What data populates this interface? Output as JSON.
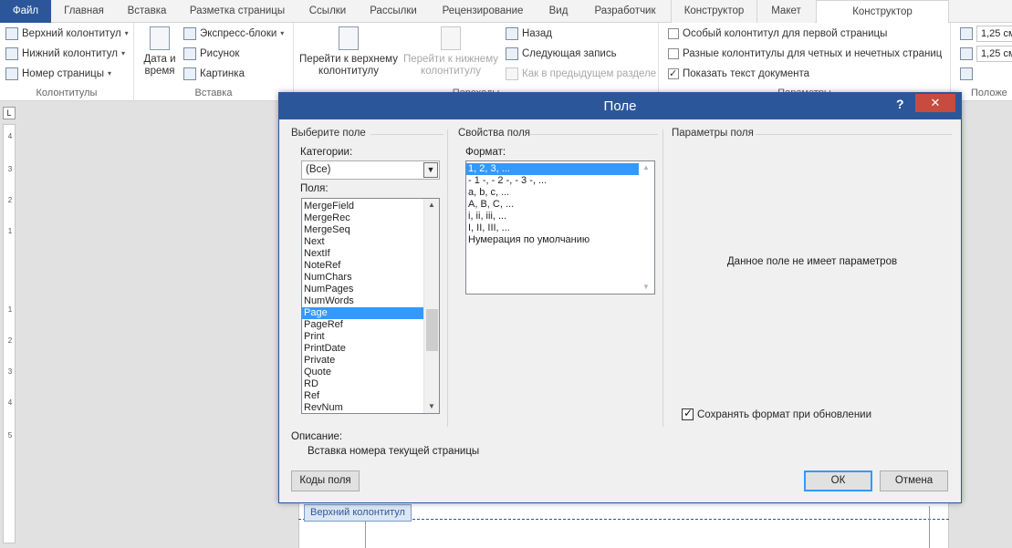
{
  "tabs": {
    "file": "Файл",
    "home": "Главная",
    "insert": "Вставка",
    "layout": "Разметка страницы",
    "references": "Ссылки",
    "mailings": "Рассылки",
    "review": "Рецензирование",
    "view": "Вид",
    "developer": "Разработчик",
    "constructor1": "Конструктор",
    "maket": "Макет",
    "constructor2": "Конструктор"
  },
  "ribbon": {
    "headers_group": {
      "label": "Колонтитулы",
      "header": "Верхний колонтитул",
      "footer": "Нижний колонтитул",
      "page_number": "Номер страницы"
    },
    "insert_group": {
      "label": "Вставка",
      "date_line1": "Дата и",
      "date_line2": "время",
      "quick_parts": "Экспресс-блоки",
      "picture": "Рисунок",
      "clip_art": "Картинка"
    },
    "nav_group": {
      "label": "Переходы",
      "goto_header_l1": "Перейти к верхнему",
      "goto_header_l2": "колонтитулу",
      "goto_footer_l1": "Перейти к нижнему",
      "goto_footer_l2": "колонтитулу",
      "back": "Назад",
      "next": "Следующая запись",
      "link_prev": "Как в предыдущем разделе"
    },
    "options_group": {
      "label": "Параметры",
      "first_page": "Особый колонтитул для первой страницы",
      "odd_even": "Разные колонтитулы для четных и нечетных страниц",
      "show_text": "Показать текст документа",
      "first_page_checked": false,
      "odd_even_checked": false,
      "show_text_checked": true
    },
    "position_group": {
      "label": "Положе",
      "top_value": "1,25 см",
      "bottom_value": "1,25 см"
    }
  },
  "ruler": {
    "numbers": [
      "4",
      "3",
      "2",
      "1",
      "1",
      "2",
      "3",
      "4",
      "5"
    ]
  },
  "document": {
    "header_tag": "Верхний колонтитул"
  },
  "dialog": {
    "title": "Поле",
    "help": "?",
    "close": "✕",
    "choose_field": "Выберите поле",
    "categories_label": "Категории:",
    "category_value": "(Все)",
    "fields_label": "Поля:",
    "fields": [
      "MergeField",
      "MergeRec",
      "MergeSeq",
      "Next",
      "NextIf",
      "NoteRef",
      "NumChars",
      "NumPages",
      "NumWords",
      "Page",
      "PageRef",
      "Print",
      "PrintDate",
      "Private",
      "Quote",
      "RD",
      "Ref",
      "RevNum"
    ],
    "selected_field": "Page",
    "field_props": "Свойства поля",
    "format_label": "Формат:",
    "formats": [
      "1, 2, 3, ...",
      "- 1 -, - 2 -, - 3 -, ...",
      "a, b, c, ...",
      "A, B, C, ...",
      "i, ii, iii, ...",
      "I, II, III, ...",
      "Нумерация по умолчанию"
    ],
    "selected_format": "1, 2, 3, ...",
    "field_params": "Параметры поля",
    "no_params": "Данное поле не имеет параметров",
    "preserve_label": "Сохранять формат при обновлении",
    "preserve_checked": true,
    "description_label": "Описание:",
    "description_text": "Вставка номера текущей страницы",
    "field_codes": "Коды поля",
    "ok": "ОК",
    "cancel": "Отмена"
  }
}
